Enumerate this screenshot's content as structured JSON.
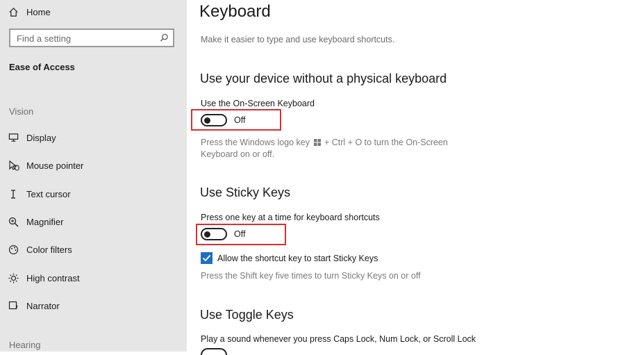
{
  "sidebar": {
    "home_label": "Home",
    "search_placeholder": "Find a setting",
    "section_title": "Ease of Access",
    "group_vision": "Vision",
    "group_hearing": "Hearing",
    "items": [
      {
        "label": "Display",
        "icon": "display-icon"
      },
      {
        "label": "Mouse pointer",
        "icon": "mouse-pointer-icon"
      },
      {
        "label": "Text cursor",
        "icon": "text-cursor-icon"
      },
      {
        "label": "Magnifier",
        "icon": "magnifier-icon"
      },
      {
        "label": "Color filters",
        "icon": "color-filters-icon"
      },
      {
        "label": "High contrast",
        "icon": "high-contrast-icon"
      },
      {
        "label": "Narrator",
        "icon": "narrator-icon"
      }
    ]
  },
  "main": {
    "title": "Keyboard",
    "description": "Make it easier to type and use keyboard shortcuts.",
    "osk": {
      "heading": "Use your device without a physical keyboard",
      "label": "Use the On-Screen Keyboard",
      "state": "Off",
      "hint_before": "Press the Windows logo key",
      "hint_after": "+ Ctrl + O to turn the On-Screen Keyboard on or off."
    },
    "sticky": {
      "heading": "Use Sticky Keys",
      "label": "Press one key at a time for keyboard shortcuts",
      "state": "Off",
      "checkbox_label": "Allow the shortcut key to start Sticky Keys",
      "hint": "Press the Shift key five times to turn Sticky Keys on or off"
    },
    "toggle_keys": {
      "heading": "Use Toggle Keys",
      "label": "Play a sound whenever you press Caps Lock, Num Lock, or Scroll Lock"
    }
  },
  "colors": {
    "highlight": "#d9302f",
    "accent": "#1f6fbf",
    "sidebar_bg": "#e6e6e6"
  }
}
